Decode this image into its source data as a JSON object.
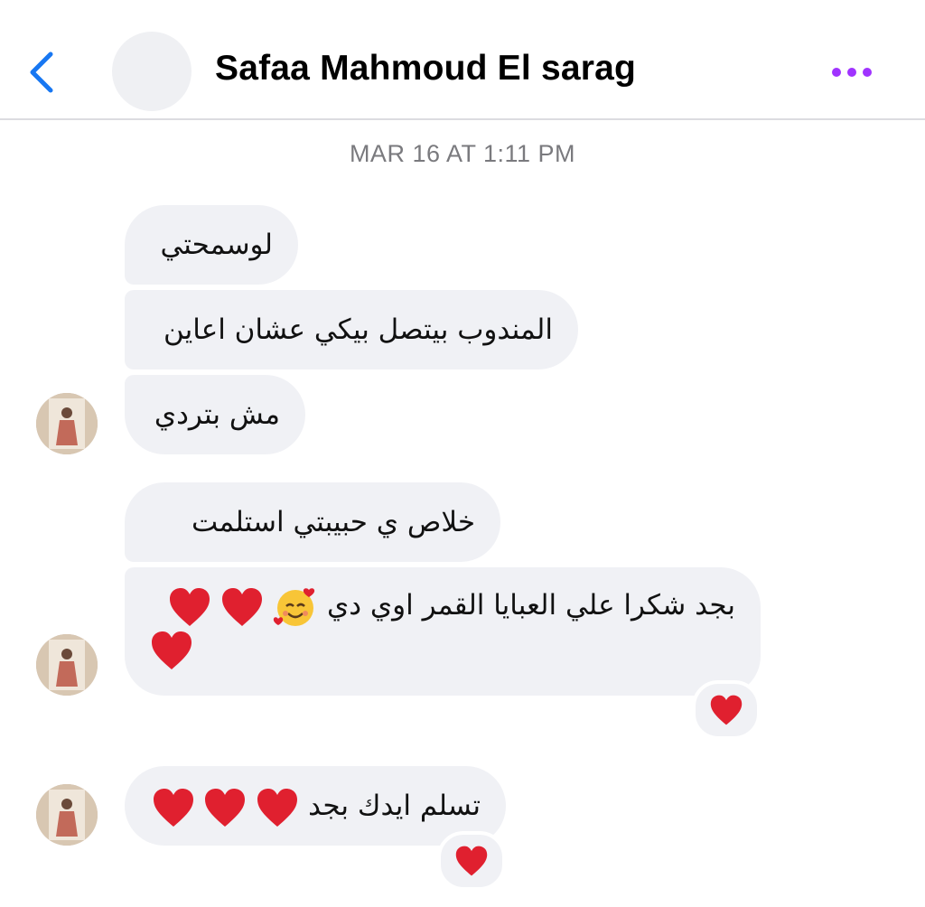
{
  "header": {
    "title": "Safaa Mahmoud El sarag",
    "back_icon": "chevron-left-icon",
    "more_icon": "ellipsis-icon",
    "accent_back": "#1877f2",
    "accent_more": "#a033ff"
  },
  "timestamp": "MAR 16 AT 1:11 PM",
  "messages": [
    {
      "text": "لوسمحتي"
    },
    {
      "text": "المندوب بيتصل بيكي عشان اعاين"
    },
    {
      "text": "مش بتردي"
    },
    {
      "text": "خلاص ي  حبيبتي استلمت"
    },
    {
      "text": "بجد شكرا علي العبايا القمر اوي دي",
      "emoji": "smiling-face-with-hearts-icon",
      "hearts": 3,
      "reaction": "red-heart-icon"
    },
    {
      "text": "تسلم ايدك بجد",
      "hearts": 3,
      "reaction": "red-heart-icon"
    }
  ],
  "colors": {
    "bubble": "#f0f1f5",
    "heart": "#e0202f"
  }
}
